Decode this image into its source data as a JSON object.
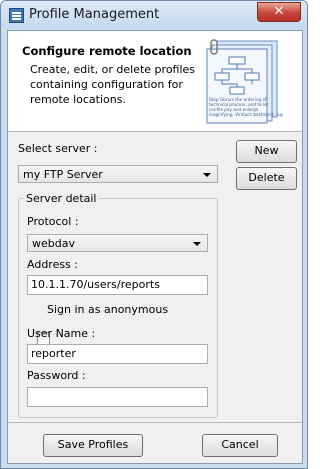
{
  "window": {
    "title": "Profile Management",
    "close_glyph": "✕"
  },
  "header": {
    "title": "Configure remote location",
    "description": "Create, edit, or delete profiles containing configuration for remote locations.",
    "illustration_text": "Stop Gbrurs the ordering of technical process, and to let confile pay and enlarge magnifying. Vintlach bestmerit, support"
  },
  "server": {
    "label": "Select server :",
    "selected": "my FTP Server",
    "new_label": "New",
    "delete_label": "Delete"
  },
  "detail": {
    "group_title": "Server detail",
    "protocol_label": "Protocol :",
    "protocol_value": "webdav",
    "address_label": "Address :",
    "address_value": "10.1.1.70/users/reports",
    "anonymous_label": "Sign in as anonymous",
    "anonymous_checked": false,
    "username_label": "User Name :",
    "username_value": "reporter",
    "password_label": "Password :",
    "password_value": ""
  },
  "footer": {
    "save_label": "Save Profiles",
    "cancel_label": "Cancel"
  }
}
